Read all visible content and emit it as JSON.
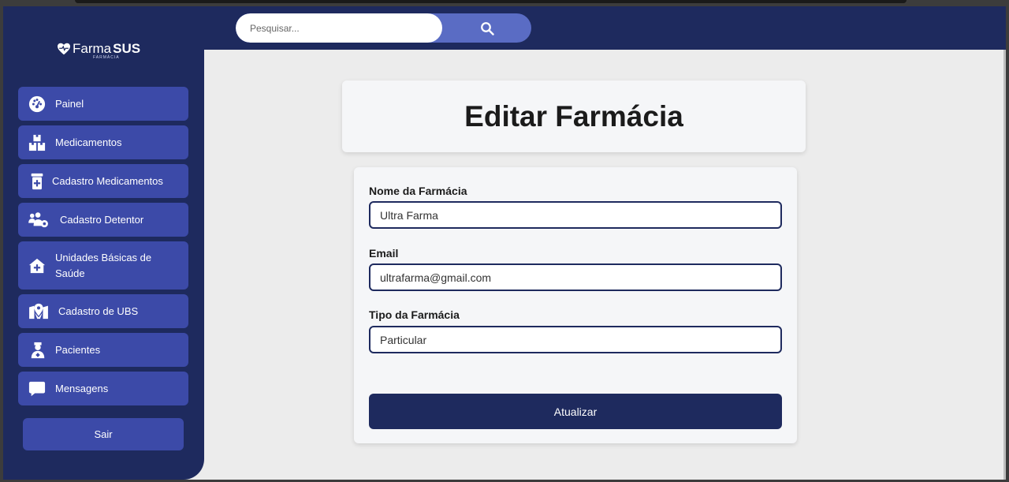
{
  "brand": {
    "name_light": "Farma",
    "name_bold": "SUS",
    "subtitle": "FARMÁCIA"
  },
  "search": {
    "placeholder": "Pesquisar..."
  },
  "sidebar": {
    "items": [
      {
        "label": "Painel",
        "icon": "gauge-icon"
      },
      {
        "label": "Medicamentos",
        "icon": "boxes-icon"
      },
      {
        "label": "Cadastro Medicamentos",
        "icon": "prescription-bottle-icon"
      },
      {
        "label": "Cadastro Detentor",
        "icon": "users-gear-icon"
      },
      {
        "label": "Unidades Básicas de Saúde",
        "icon": "house-medical-icon"
      },
      {
        "label": "Cadastro de UBS",
        "icon": "map-location-icon"
      },
      {
        "label": "Pacientes",
        "icon": "user-nurse-icon"
      },
      {
        "label": "Mensagens",
        "icon": "message-icon"
      }
    ],
    "logout_label": "Sair"
  },
  "page": {
    "title": "Editar Farmácia"
  },
  "form": {
    "name_label": "Nome da Farmácia",
    "name_value": "Ultra Farma",
    "email_label": "Email",
    "email_value": "ultrafarma@gmail.com",
    "type_label": "Tipo da Farmácia",
    "type_value": "Particular",
    "submit_label": "Atualizar"
  },
  "colors": {
    "navy": "#1e2a5e",
    "nav_button": "#3c4aa8",
    "search_button": "#5a6cc4",
    "content_bg": "#ececec"
  }
}
